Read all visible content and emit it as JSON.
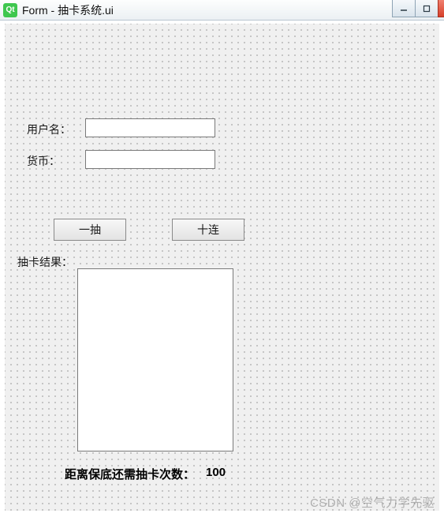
{
  "window": {
    "icon_text": "Qt",
    "title": "Form - 抽卡系统.ui"
  },
  "form": {
    "username_label": "用户名：",
    "username_value": "",
    "currency_label": "货币：",
    "currency_value": ""
  },
  "buttons": {
    "single_pull": "一抽",
    "ten_pull": "十连"
  },
  "results": {
    "label": "抽卡结果："
  },
  "pity": {
    "label": "距离保底还需抽卡次数：",
    "value": "100"
  },
  "watermark": "CSDN @空气力学先驱"
}
